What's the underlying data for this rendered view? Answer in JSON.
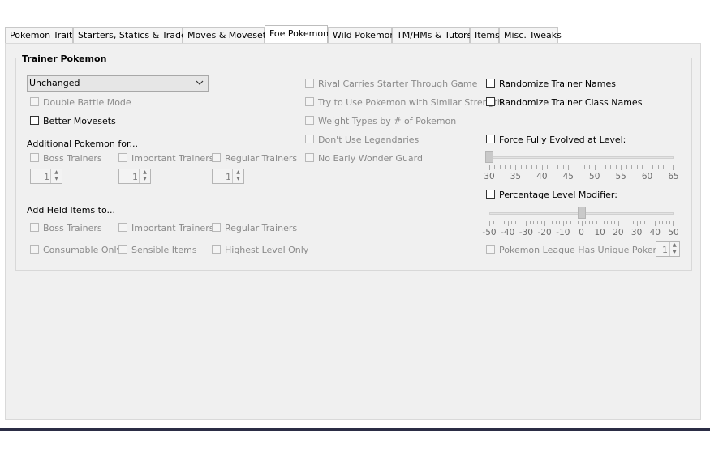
{
  "tabs": [
    {
      "label": "Pokemon Traits"
    },
    {
      "label": "Starters, Statics & Trades"
    },
    {
      "label": "Moves & Movesets"
    },
    {
      "label": "Foe Pokemon",
      "active": true
    },
    {
      "label": "Wild Pokemon"
    },
    {
      "label": "TM/HMs & Tutors"
    },
    {
      "label": "Items"
    },
    {
      "label": "Misc. Tweaks"
    }
  ],
  "group": {
    "title": "Trainer Pokemon"
  },
  "combo": {
    "value": "Unchanged",
    "icon": "chevron-down-icon"
  },
  "left": {
    "double_battle": "Double Battle Mode",
    "better_movesets": "Better Movesets",
    "additional_header": "Additional Pokemon for...",
    "boss": "Boss Trainers",
    "important": "Important Trainers",
    "regular": "Regular Trainers",
    "spin_boss": "1",
    "spin_important": "1",
    "spin_regular": "1",
    "held_header": "Add Held Items to...",
    "held_boss": "Boss Trainers",
    "held_important": "Important Trainers",
    "held_regular": "Regular Trainers",
    "consumable": "Consumable Only",
    "sensible": "Sensible Items",
    "highest": "Highest Level Only"
  },
  "middle": {
    "rival": "Rival Carries Starter Through Game",
    "similar": "Try to Use Pokemon with Similar Strength",
    "weight": "Weight Types by # of Pokemon",
    "legend": "Don't Use Legendaries",
    "wonder": "No Early Wonder Guard"
  },
  "right": {
    "rand_names": "Randomize Trainer Names",
    "rand_class": "Randomize Trainer Class Names",
    "force_evolved": "Force Fully Evolved at Level:",
    "level_slider": {
      "value": 30,
      "labels": [
        "30",
        "35",
        "40",
        "45",
        "50",
        "55",
        "60",
        "65"
      ]
    },
    "pct_modifier": "Percentage Level Modifier:",
    "pct_slider": {
      "value": 0,
      "labels": [
        "-50",
        "-40",
        "-30",
        "-20",
        "-10",
        "0",
        "10",
        "20",
        "30",
        "40",
        "50"
      ]
    },
    "league_unique": "Pokemon League Has Unique Pokemon:",
    "spin_league": "1"
  }
}
